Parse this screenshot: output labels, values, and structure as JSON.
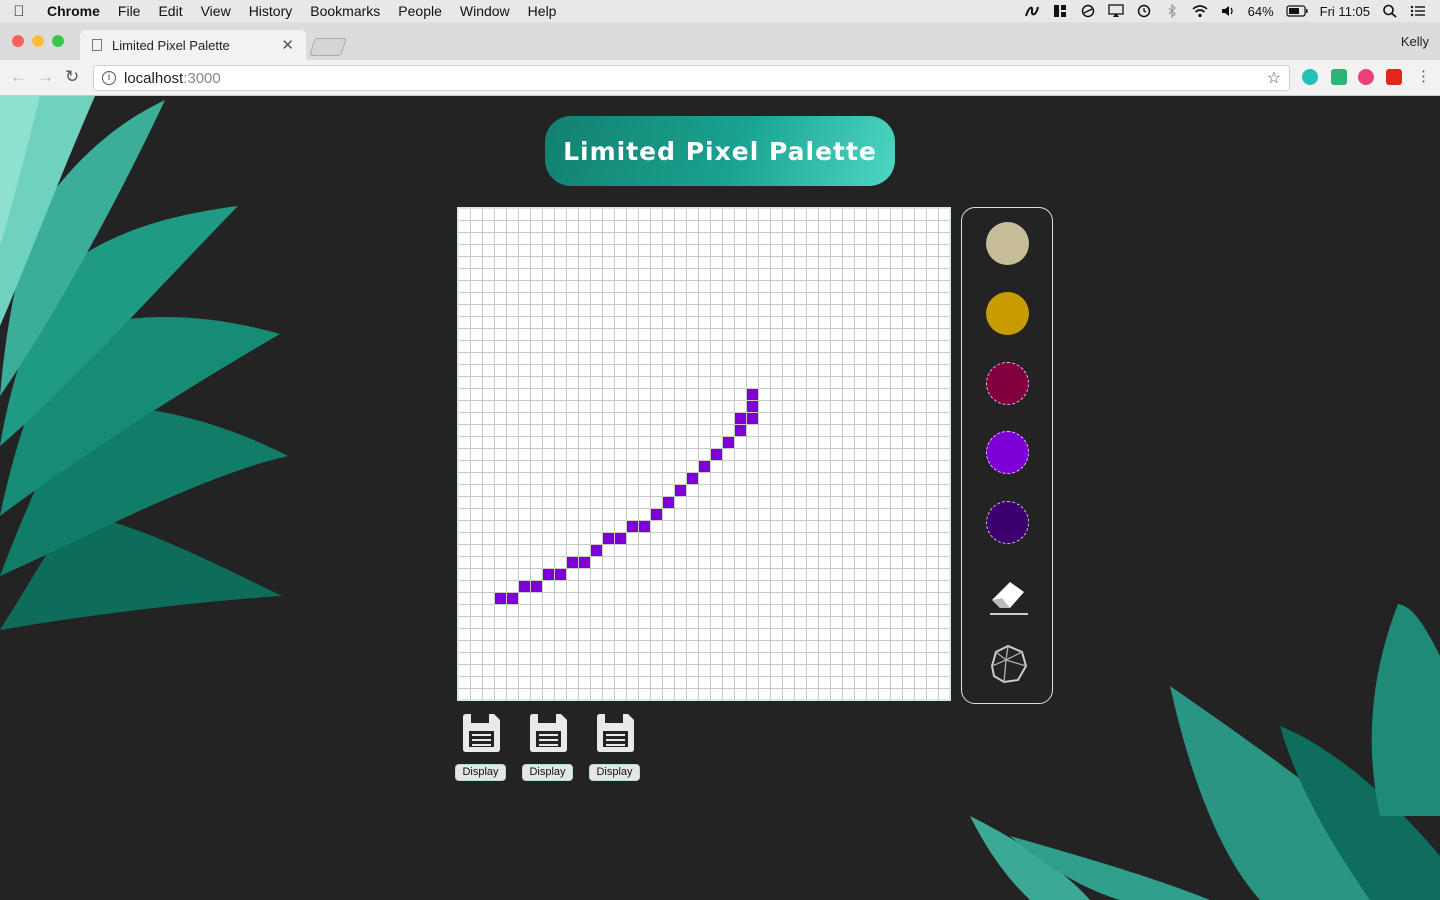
{
  "menubar": {
    "app": "Chrome",
    "items": [
      "File",
      "Edit",
      "View",
      "History",
      "Bookmarks",
      "People",
      "Window",
      "Help"
    ],
    "battery": "64%",
    "clock": "Fri 11:05"
  },
  "tab": {
    "title": "Limited Pixel Palette"
  },
  "profile": "Kelly",
  "address": {
    "host": "localhost",
    "port": ":3000"
  },
  "app": {
    "title": "Limited Pixel Palette"
  },
  "palette": {
    "colors": [
      "#c7be99",
      "#c89b00",
      "#7f0040",
      "#7f00d6",
      "#3d0070"
    ],
    "tools": [
      "eraser-icon",
      "crumple-clear-icon"
    ]
  },
  "canvas": {
    "grid_size": 41,
    "painted_color": "#7f00d6",
    "painted_cells": [
      [
        24,
        15
      ],
      [
        24,
        16
      ],
      [
        23,
        17
      ],
      [
        24,
        17
      ],
      [
        23,
        18
      ],
      [
        22,
        19
      ],
      [
        21,
        20
      ],
      [
        20,
        21
      ],
      [
        19,
        22
      ],
      [
        18,
        23
      ],
      [
        17,
        24
      ],
      [
        16,
        25
      ],
      [
        15,
        26
      ],
      [
        14,
        26
      ],
      [
        13,
        27
      ],
      [
        12,
        27
      ],
      [
        11,
        28
      ],
      [
        10,
        29
      ],
      [
        9,
        29
      ],
      [
        8,
        30
      ],
      [
        7,
        30
      ],
      [
        6,
        31
      ],
      [
        5,
        31
      ],
      [
        4,
        32
      ],
      [
        3,
        32
      ]
    ]
  },
  "saves": [
    {
      "label": "Display"
    },
    {
      "label": "Display"
    },
    {
      "label": "Display"
    }
  ]
}
